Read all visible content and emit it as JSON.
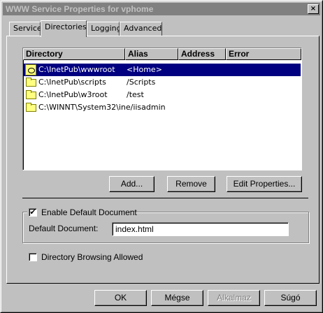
{
  "window": {
    "title": "WWW Service Properties for vphome",
    "close_glyph": "×"
  },
  "tabs": [
    {
      "label": "Service"
    },
    {
      "label": "Directories"
    },
    {
      "label": "Logging"
    },
    {
      "label": "Advanced"
    }
  ],
  "directory_list": {
    "columns": [
      "Directory",
      "Alias",
      "Address",
      "Error"
    ],
    "rows": [
      {
        "directory": "C:\\InetPub\\wwwroot",
        "alias": "<Home>",
        "selected": true,
        "icon": "home-folder-icon"
      },
      {
        "directory": "C:\\InetPub\\scripts",
        "alias": "/Scripts",
        "icon": "folder-icon"
      },
      {
        "directory": "C:\\InetPub\\w3root",
        "alias": "/test",
        "icon": "folder-icon"
      },
      {
        "directory": "C:\\WINNT\\System32\\ine/iisadmin",
        "alias": "",
        "icon": "folder-icon"
      }
    ]
  },
  "buttons": {
    "add": "Add...",
    "remove": "Remove",
    "edit_properties": "Edit Properties..."
  },
  "default_document": {
    "checkbox_label": "Enable Default Document",
    "checked": true,
    "field_label": "Default Document:",
    "value": "index.html"
  },
  "directory_browsing": {
    "label": "Directory Browsing Allowed",
    "checked": false
  },
  "footer": {
    "ok": "OK",
    "cancel": "Mégse",
    "apply": "Alkalmaz",
    "help": "Súgó"
  }
}
